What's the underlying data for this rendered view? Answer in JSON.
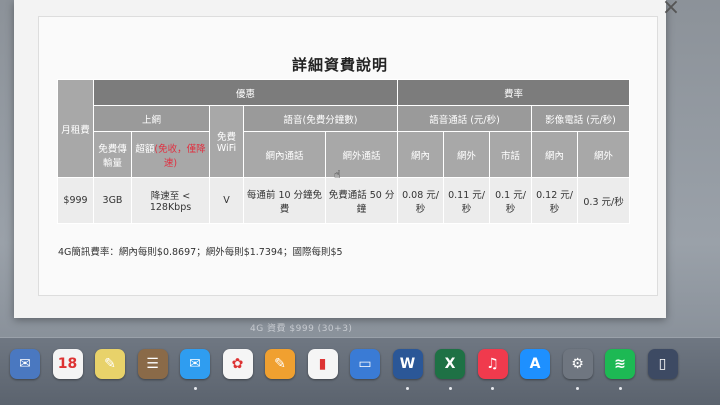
{
  "modal": {
    "title": "詳細資費說明",
    "close_glyph": "×"
  },
  "table": {
    "monthly_fee_header": "月租費",
    "promo_header": "優惠",
    "rate_header": "費率",
    "data_header": "上網",
    "free_data_header": "免費傳輸量",
    "overage_header_prefix": "超額",
    "overage_header_red": "(免收，僅降速)",
    "free_wifi_header": "免費WiFi",
    "voice_header": "語音(免費分鐘數)",
    "onnet_call_header": "網內通話",
    "offnet_call_header": "網外通話",
    "voice_rate_header": "語音通話 (元/秒)",
    "video_rate_header": "影像電話 (元/秒)",
    "onnet": "網內",
    "offnet": "網外",
    "landline": "市話",
    "row": {
      "monthly": "$999",
      "free_data": "3GB",
      "overage": "降速至 < 128Kbps",
      "wifi": "V",
      "onnet_free": "每通前 10 分鐘免費",
      "offnet_free": "免費通話 50 分鐘",
      "voice_onnet": "0.08 元/秒",
      "voice_offnet": "0.11 元/秒",
      "voice_landline": "0.1 元/秒",
      "video_onnet": "0.12 元/秒",
      "video_offnet": "0.3 元/秒"
    }
  },
  "note": "4G簡訊費率：網內每則$0.8697；網外每則$1.7394；國際每則$5",
  "underlying_text": "4G 資費 $999 (30+3)",
  "dock": {
    "items": [
      {
        "name": "preview",
        "glyph": "✉",
        "color": "#4a78c0"
      },
      {
        "name": "calendar",
        "glyph": "18",
        "color": "#f4f4f4"
      },
      {
        "name": "notes",
        "glyph": "✎",
        "color": "#e8d26a"
      },
      {
        "name": "contacts",
        "glyph": "☰",
        "color": "#8a6a48"
      },
      {
        "name": "messages",
        "glyph": "✉",
        "color": "#2f9df0"
      },
      {
        "name": "photos",
        "glyph": "✿",
        "color": "#f5f5f5"
      },
      {
        "name": "pages",
        "glyph": "✎",
        "color": "#f0a030"
      },
      {
        "name": "numbers",
        "glyph": "▮",
        "color": "#f5f5f5"
      },
      {
        "name": "keynote",
        "glyph": "▭",
        "color": "#3a7bd5"
      },
      {
        "name": "word",
        "glyph": "W",
        "color": "#2b5797"
      },
      {
        "name": "excel",
        "glyph": "X",
        "color": "#1e7145"
      },
      {
        "name": "itunes",
        "glyph": "♫",
        "color": "#f03a4d"
      },
      {
        "name": "app-store",
        "glyph": "A",
        "color": "#1e90ff"
      },
      {
        "name": "system-preferences",
        "glyph": "⚙",
        "color": "#6f7680"
      },
      {
        "name": "spotify",
        "glyph": "≋",
        "color": "#1db954"
      },
      {
        "name": "iphone-backup",
        "glyph": "▯",
        "color": "#3d4a63"
      }
    ]
  }
}
